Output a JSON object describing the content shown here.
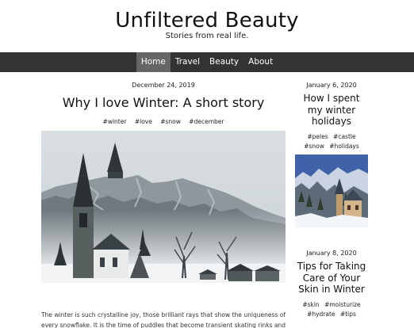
{
  "site": {
    "title": "Unfiltered Beauty",
    "tagline": "Stories from real life."
  },
  "nav": {
    "items": [
      {
        "label": "Home",
        "active": true
      },
      {
        "label": "Travel",
        "active": false
      },
      {
        "label": "Beauty",
        "active": false
      },
      {
        "label": "About",
        "active": false
      }
    ],
    "background": "#333333",
    "active_background": "#666666"
  },
  "post": {
    "date": "December 24, 2019",
    "title": "Why I love Winter: A short story",
    "tags": [
      "#winter",
      "#love",
      "#snow",
      "#december"
    ],
    "excerpt": "The winter is such crystalline joy, those brilliant rays that show the uniqueness of every snowflake. It is the time of puddles that become transient skating rinks and for"
  },
  "sidebar": {
    "posts": [
      {
        "date": "January 6, 2020",
        "title": "How I spent my winter holidays",
        "tags": [
          "#peles",
          "#castle",
          "#snow",
          "#holidays"
        ]
      },
      {
        "date": "January 8, 2020",
        "title": "Tips for Taking Care of Your Skin in Winter",
        "tags": [
          "#skin",
          "#moisturize",
          "#hydrate",
          "#tips"
        ]
      }
    ]
  }
}
